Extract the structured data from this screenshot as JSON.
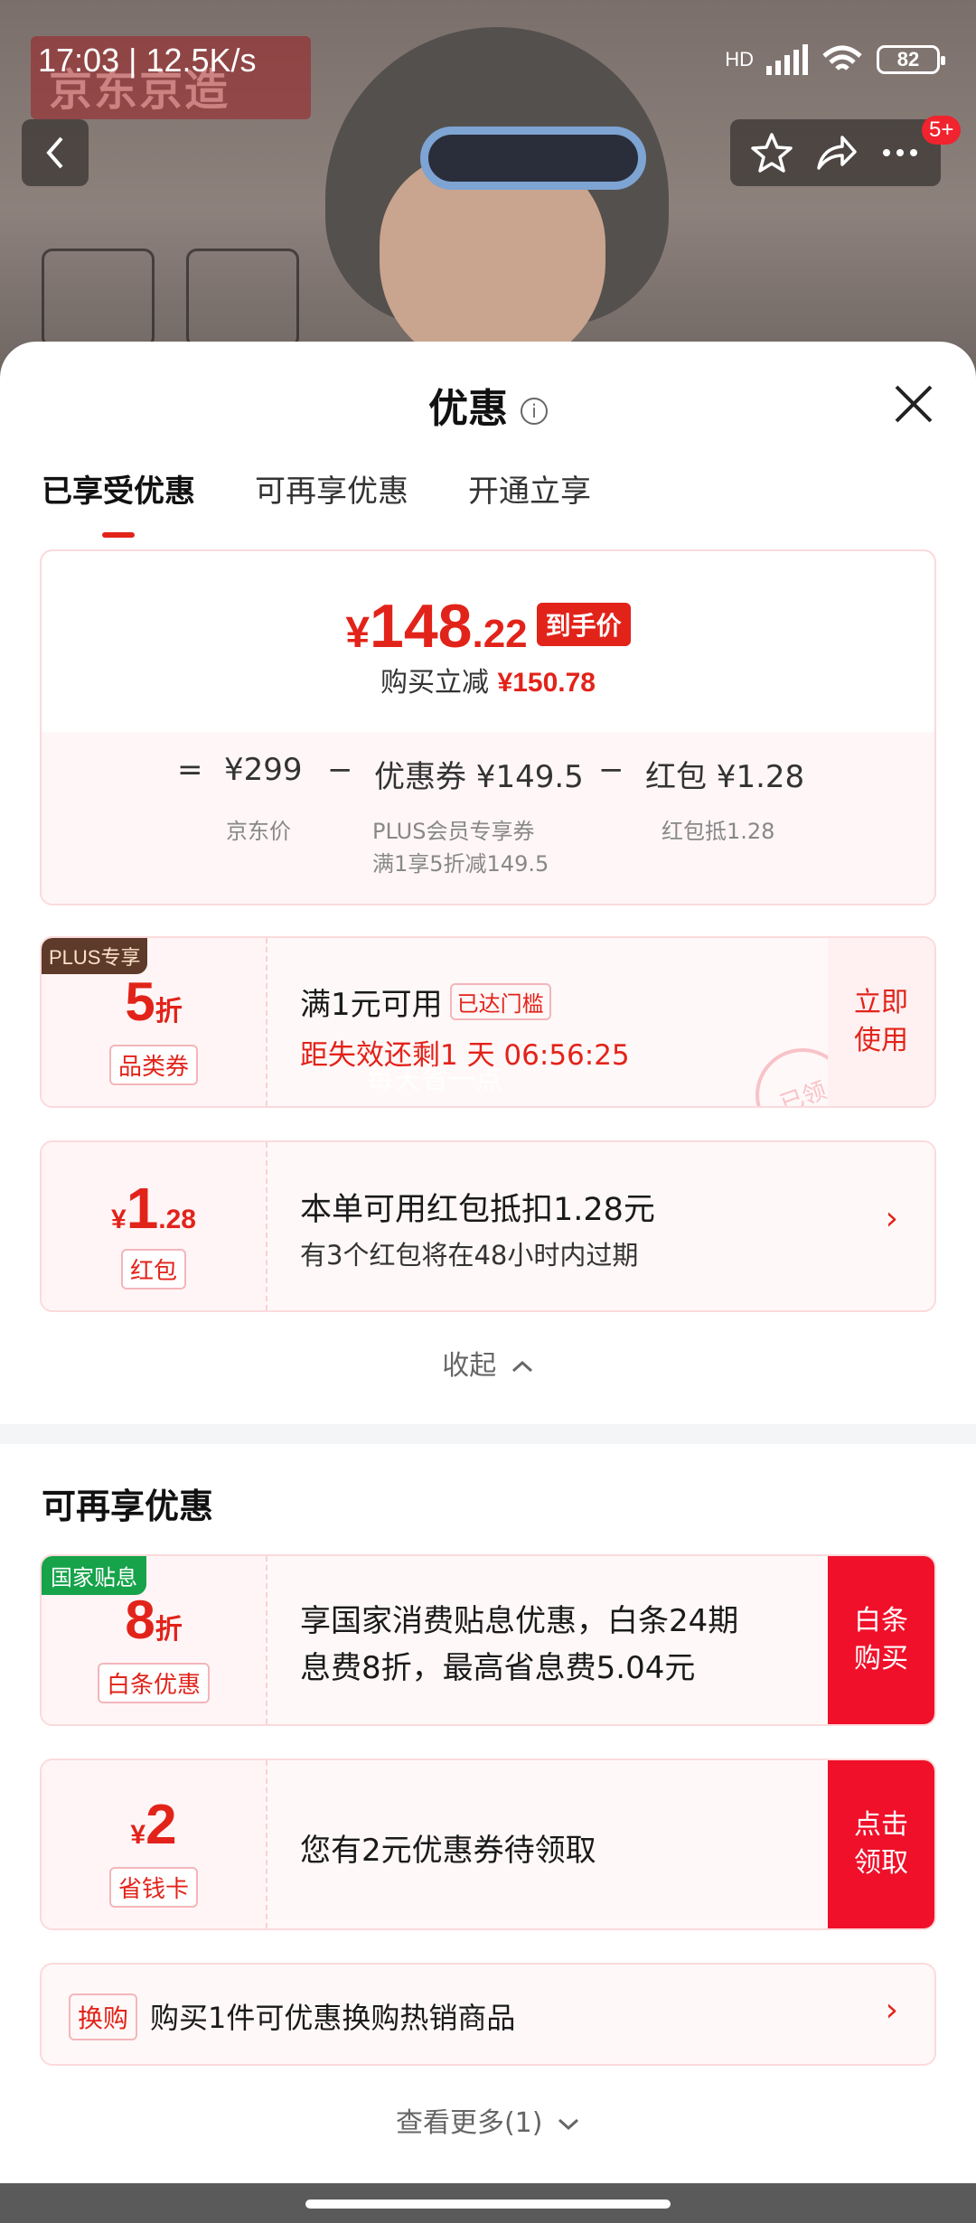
{
  "status_bar": {
    "time_speed": "17:03 | 12.5K/s",
    "network": "HD",
    "battery": "82"
  },
  "background": {
    "brand_text": "京东京造"
  },
  "top_actions": {
    "badge": "5+"
  },
  "sheet": {
    "title": "优惠",
    "info_icon": "i",
    "tabs": [
      {
        "label": "已享受优惠"
      },
      {
        "label": "可再享优惠"
      },
      {
        "label": "开通立享"
      }
    ],
    "price_card": {
      "yen": "¥",
      "price_int": "148",
      "price_dec": ".22",
      "price_tag": "到手价",
      "reduce_label": "购买立减",
      "reduce_value": "¥150.78",
      "eq": "=",
      "jd_price": "¥299",
      "minus": "−",
      "coupon_part": "优惠券 ¥149.5",
      "redpack_part": "红包 ¥1.28",
      "jd_label": "京东价",
      "coupon_label_1": "PLUS会员专享券",
      "coupon_label_2": "满1享5折减149.5",
      "redpack_label": "红包抵1.28"
    },
    "coupon1": {
      "badge": "PLUS专享",
      "value": "5",
      "unit": "折",
      "tag": "品类券",
      "title": "满1元可用",
      "status_tag": "已达门槛",
      "countdown": "距失效还剩1 天 06:56:25",
      "watermark": "每天省一点",
      "stamp": "已领",
      "action": "立即使用"
    },
    "coupon2": {
      "yen": "¥",
      "value_int": "1",
      "value_dec": ".28",
      "tag": "红包",
      "title": "本单可用红包抵扣1.28元",
      "sub": "有3个红包将在48小时内过期",
      "chevron": "›"
    },
    "collapse_label": "收起",
    "section_title": "可再享优惠",
    "coupon3": {
      "badge": "国家贴息",
      "value": "8",
      "unit": "折",
      "tag": "白条优惠",
      "line1": "享国家消费贴息优惠，白条24期",
      "line2": "息费8折，最高省息费5.04元",
      "action": "白条购买"
    },
    "coupon4": {
      "yen": "¥",
      "value": "2",
      "tag": "省钱卡",
      "title": "您有2元优惠券待领取",
      "action": "点击领取"
    },
    "exchange": {
      "tag": "换购",
      "title": "购买1件可优惠换购热销商品",
      "chevron": "›"
    },
    "more_label": "查看更多(1)"
  }
}
